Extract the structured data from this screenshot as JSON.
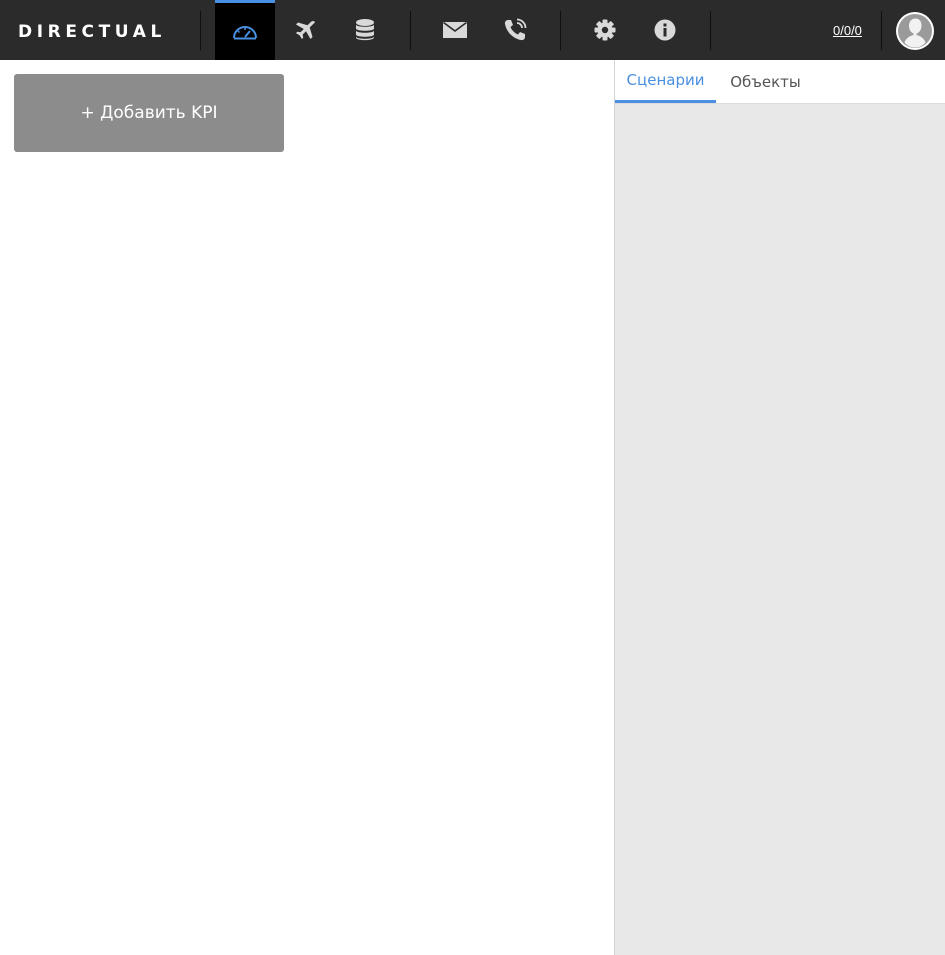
{
  "header": {
    "logo_text": "DIRECTUAL",
    "counter": "0/0/0",
    "accent_color": "#4a90e2",
    "nav_icons": [
      "dashboard-gauge-icon",
      "plane-icon",
      "database-icon",
      "mail-icon",
      "phone-icon",
      "gear-icon",
      "info-icon"
    ],
    "active_nav": "dashboard-gauge-icon"
  },
  "main": {
    "add_kpi_label": "+ Добавить KPI"
  },
  "right_panel": {
    "tabs": [
      {
        "label": "Сценарии",
        "active": true
      },
      {
        "label": "Объекты",
        "active": false
      }
    ]
  }
}
